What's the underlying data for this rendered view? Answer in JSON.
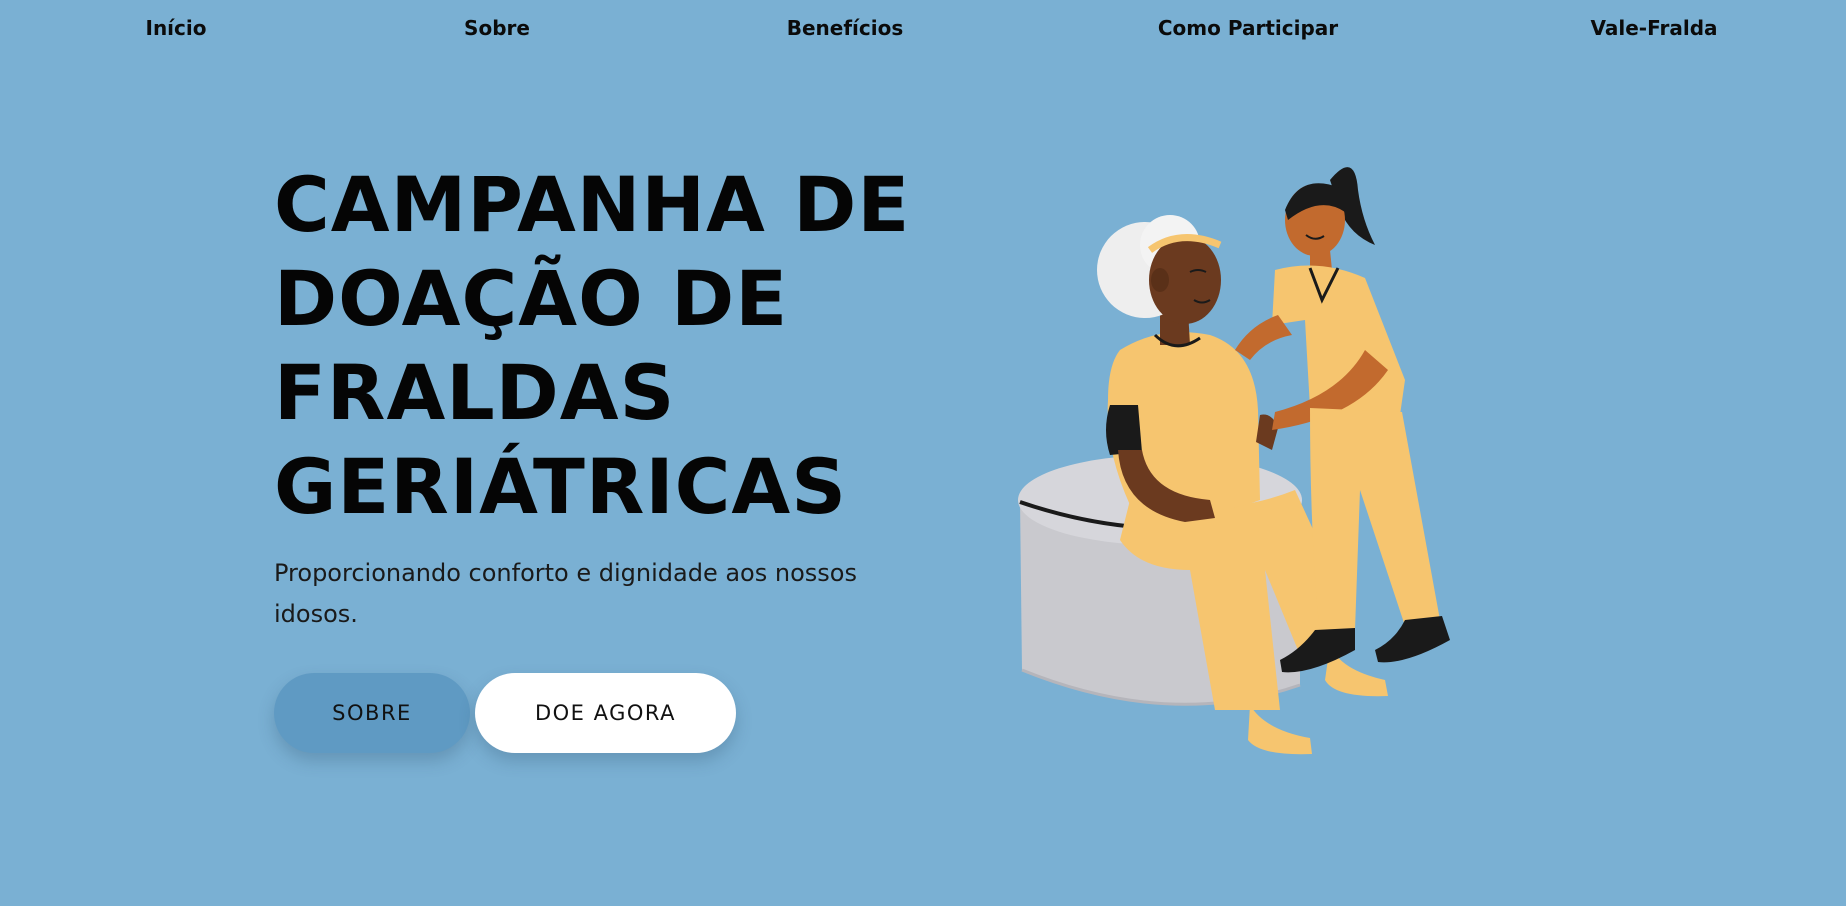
{
  "nav": {
    "items": [
      {
        "label": "Início"
      },
      {
        "label": "Sobre"
      },
      {
        "label": "Benefícios"
      },
      {
        "label": "Como Participar"
      },
      {
        "label": "Vale-Fralda"
      }
    ]
  },
  "hero": {
    "title_lines": [
      "CAMPANHA DE",
      "DOAÇÃO DE",
      "FRALDAS",
      "GERIÁTRICAS"
    ],
    "subtitle": "Proporcionando conforto e dignidade aos nossos idosos.",
    "buttons": {
      "sobre": "SOBRE",
      "doe": "DOE AGORA"
    },
    "illustration": {
      "icon": "caregiver-with-elderly-woman-illustration"
    }
  },
  "colors": {
    "background": "#7ab0d3",
    "button_primary": "#5f9ac3",
    "button_secondary": "#ffffff",
    "text": "#0b0b0b",
    "uniform": "#f6c56f",
    "skin_dark": "#6b3a1f",
    "skin_nurse": "#c26a2e",
    "stool": "#d1d1d6"
  }
}
